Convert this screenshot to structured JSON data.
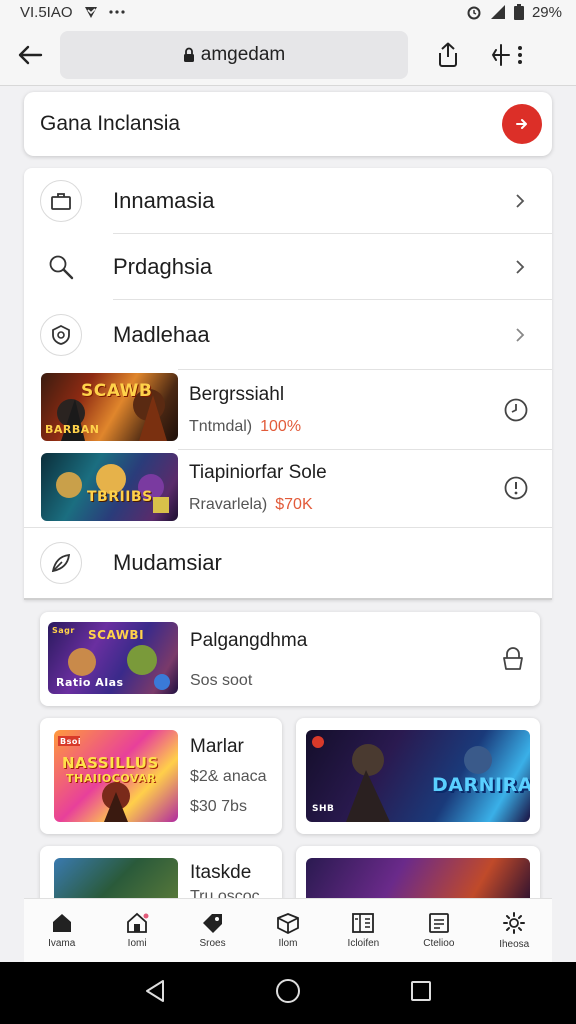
{
  "status_bar": {
    "time": "VI.5IAO",
    "battery": "29%"
  },
  "browser": {
    "url": "amgedam"
  },
  "header": {
    "title": "Gana Inclansia"
  },
  "menu": {
    "items": [
      {
        "label": "Innamasia",
        "icon": "briefcase-icon"
      },
      {
        "label": "Prdaghsia",
        "icon": "search-icon"
      },
      {
        "label": "Madlehaa",
        "icon": "shield-gear-icon"
      }
    ],
    "games": [
      {
        "title": "Bergrssiahl",
        "sub": "Tntmdal)",
        "accent": "100%",
        "art_text": "SCAWB",
        "art_corner": "BARBAN"
      },
      {
        "title": "Tiapiniorfar Sole",
        "sub": "Rravarlela)",
        "accent": "$70K",
        "art_text": "TBRIIBS",
        "art_corner": ""
      }
    ],
    "last_item": {
      "label": "Mudamsiar",
      "icon": "leaf-icon"
    }
  },
  "promos": {
    "wide": {
      "title": "Palgangdhma",
      "sub": "Sos soot",
      "art_text": "SCAWBI",
      "art_corner": "Ratio Alas",
      "badge": "Sagr"
    },
    "left": {
      "title": "Marlar",
      "line1": "$2& anaca",
      "line2": "$30 7bs",
      "art_text": "NASSILLUS",
      "art_sub": "THAIIOCOVAR",
      "badge": "Bsoi"
    },
    "right": {
      "art_text": "DARNIRA",
      "corner": "SHB"
    },
    "left2": {
      "title": "Itaskde",
      "sub": "Tru oscoc"
    }
  },
  "bottom_nav": [
    {
      "label": "Ivama",
      "icon": "home-icon"
    },
    {
      "label": "Iomi",
      "icon": "house-outline-icon"
    },
    {
      "label": "Sroes",
      "icon": "tag-icon"
    },
    {
      "label": "Ilom",
      "icon": "cube-icon"
    },
    {
      "label": "Icloifen",
      "icon": "grid-doc-icon"
    },
    {
      "label": "Ctelioo",
      "icon": "list-doc-icon"
    },
    {
      "label": "Iheosa",
      "icon": "gear-icon"
    }
  ]
}
